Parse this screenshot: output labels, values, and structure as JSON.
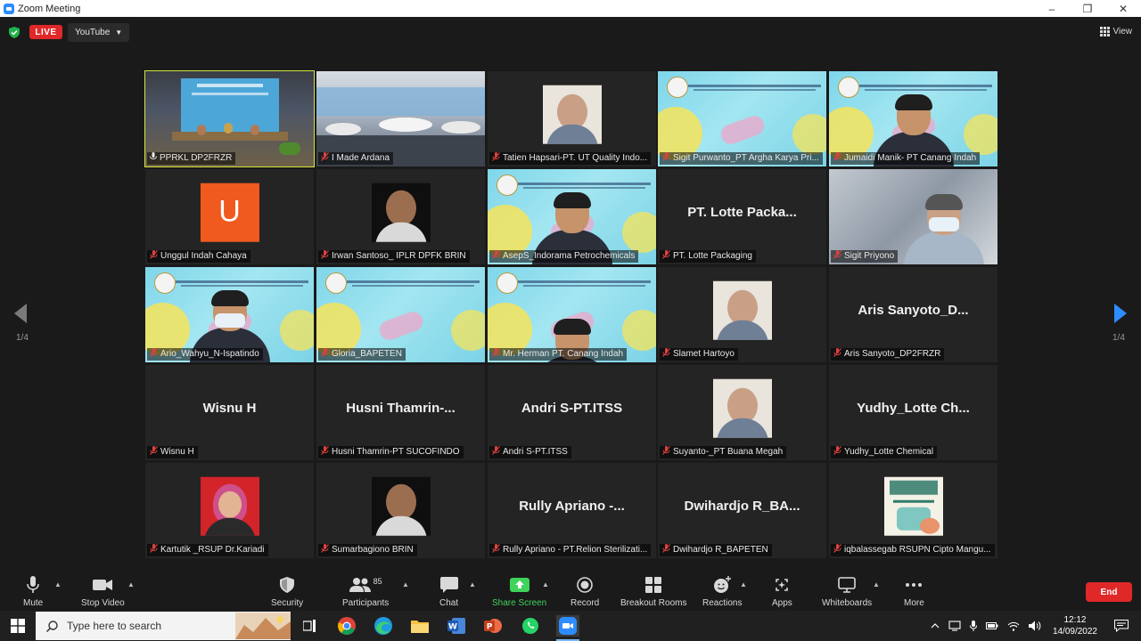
{
  "window": {
    "title": "Zoom Meeting"
  },
  "topbar": {
    "live_label": "LIVE",
    "stream_label": "YouTube",
    "view_label": "View"
  },
  "pagination": {
    "left_page": "1/4",
    "right_page": "1/4"
  },
  "participants": [
    {
      "name": "PPRKL DP2FRZR",
      "type": "room",
      "active": true
    },
    {
      "name": "I Made Ardana",
      "type": "hall"
    },
    {
      "name": "Tatien Hapsari-PT. UT Quality Indo...",
      "type": "photo"
    },
    {
      "name": "Sigit Purwanto_PT Argha Karya Pri...",
      "type": "konsultasi",
      "person": false
    },
    {
      "name": "Jumaidi Manik- PT Canang Indah",
      "type": "konsultasi",
      "person": true
    },
    {
      "name": "Unggul Indah Cahaya",
      "type": "avatar",
      "letter": "U"
    },
    {
      "name": "Irwan Santoso_ IPLR DPFK BRIN",
      "type": "photo-dark"
    },
    {
      "name": "AsepS_Indorama Petrochemicals",
      "type": "konsultasi",
      "person": true
    },
    {
      "name": "PT. Lotte Packaging",
      "type": "text",
      "display": "PT. Lotte Packa..."
    },
    {
      "name": "Sigit Priyono",
      "type": "office"
    },
    {
      "name": "Ario_Wahyu_N-Ispatindo",
      "type": "konsultasi",
      "person": true,
      "mask": true
    },
    {
      "name": "Gloria_BAPETEN",
      "type": "konsultasi",
      "person": false
    },
    {
      "name": "Mr. Herman PT. Canang Indah",
      "type": "konsultasi",
      "person": true,
      "low": true
    },
    {
      "name": "Slamet Hartoyo",
      "type": "photo"
    },
    {
      "name": "Aris Sanyoto_DP2FRZR",
      "type": "text",
      "display": "Aris Sanyoto_D..."
    },
    {
      "name": "Wisnu H",
      "type": "text",
      "display": "Wisnu H"
    },
    {
      "name": "Husni Thamrin-PT SUCOFINDO",
      "type": "text",
      "display": "Husni Thamrin-..."
    },
    {
      "name": "Andri S-PT.ITSS",
      "type": "text",
      "display": "Andri S-PT.ITSS"
    },
    {
      "name": "Suyanto-_PT Buana Megah",
      "type": "photo"
    },
    {
      "name": "Yudhy_Lotte Chemical",
      "type": "text",
      "display": "Yudhy_Lotte Ch..."
    },
    {
      "name": "Kartutik _RSUP Dr.Kariadi",
      "type": "photo-red"
    },
    {
      "name": "Sumarbagiono BRIN",
      "type": "photo-dark"
    },
    {
      "name": "Rully Apriano - PT.Relion Sterilizati...",
      "type": "text",
      "display": "Rully Apriano -..."
    },
    {
      "name": "Dwihardjo R_BAPETEN",
      "type": "text",
      "display": "Dwihardjo  R_BA..."
    },
    {
      "name": "iqbalassegab RSUPN Cipto Mangu...",
      "type": "poster"
    }
  ],
  "toolbar": {
    "mute": "Mute",
    "stop_video": "Stop Video",
    "security": "Security",
    "participants": "Participants",
    "participants_count": "85",
    "chat": "Chat",
    "share_screen": "Share Screen",
    "record": "Record",
    "breakout_rooms": "Breakout Rooms",
    "reactions": "Reactions",
    "apps": "Apps",
    "whiteboards": "Whiteboards",
    "more": "More",
    "end": "End"
  },
  "taskbar": {
    "search_placeholder": "Type here to search",
    "time": "12:12",
    "date": "14/09/2022"
  },
  "colors": {
    "accent": "#2d8cff",
    "share_green": "#3fd35a",
    "end_red": "#e02828",
    "active_speaker": "#d6e63b",
    "avatar_orange": "#f05a1e"
  }
}
